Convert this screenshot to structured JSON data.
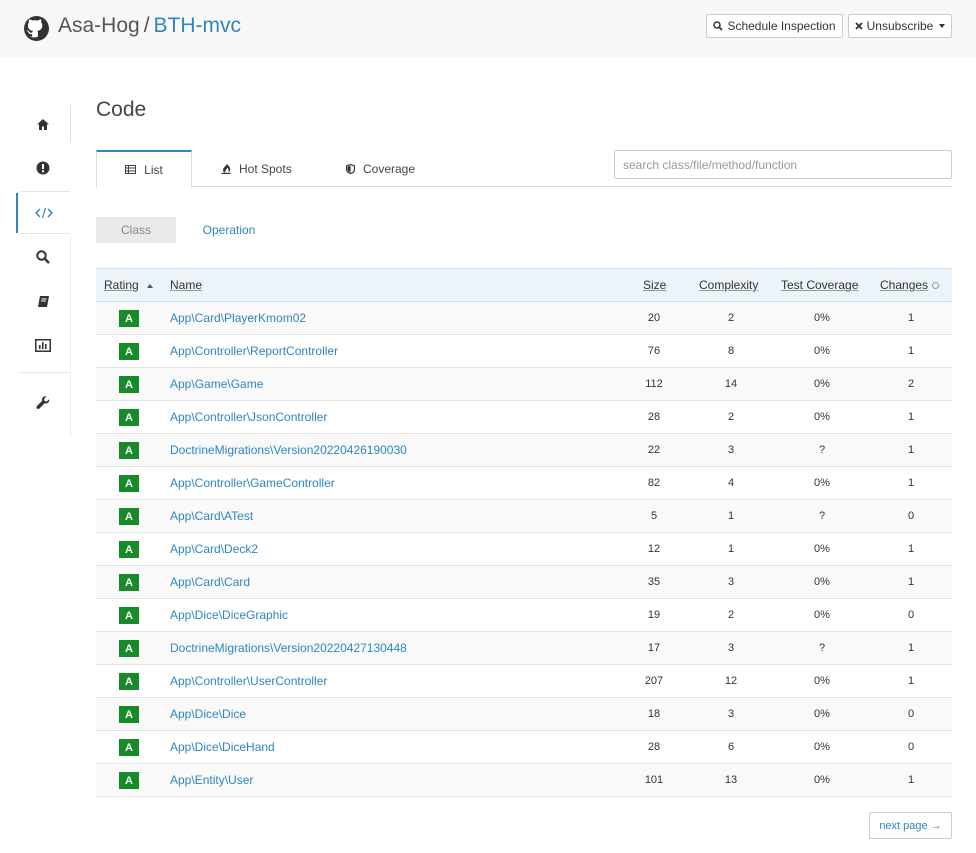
{
  "header": {
    "owner": "Asa-Hog",
    "separator": "/",
    "repo": "BTH-mvc",
    "schedule_label": "Schedule Inspection",
    "unsubscribe_label": "Unsubscribe"
  },
  "sidebar": {
    "items": [
      {
        "icon": "home-icon",
        "active": false
      },
      {
        "icon": "alert-icon",
        "active": false
      },
      {
        "icon": "code-icon",
        "active": true
      },
      {
        "icon": "search-icon",
        "active": false
      },
      {
        "icon": "book-icon",
        "active": false
      },
      {
        "icon": "chart-icon",
        "active": false
      },
      {
        "icon": "wrench-icon",
        "active": false
      }
    ]
  },
  "page": {
    "title": "Code"
  },
  "tabs": {
    "list": "List",
    "hotspots": "Hot Spots",
    "coverage": "Coverage"
  },
  "search": {
    "placeholder": "search class/file/method/function"
  },
  "subtabs": {
    "class": "Class",
    "operation": "Operation"
  },
  "table": {
    "headers": {
      "rating": "Rating",
      "name": "Name",
      "size": "Size",
      "complexity": "Complexity",
      "coverage": "Test Coverage",
      "changes": "Changes"
    },
    "rows": [
      {
        "rating": "A",
        "name": "App\\Card\\PlayerKmom02",
        "size": "20",
        "complexity": "2",
        "coverage": "0%",
        "changes": "1"
      },
      {
        "rating": "A",
        "name": "App\\Controller\\ReportController",
        "size": "76",
        "complexity": "8",
        "coverage": "0%",
        "changes": "1"
      },
      {
        "rating": "A",
        "name": "App\\Game\\Game",
        "size": "112",
        "complexity": "14",
        "coverage": "0%",
        "changes": "2"
      },
      {
        "rating": "A",
        "name": "App\\Controller\\JsonController",
        "size": "28",
        "complexity": "2",
        "coverage": "0%",
        "changes": "1"
      },
      {
        "rating": "A",
        "name": "DoctrineMigrations\\Version20220426190030",
        "size": "22",
        "complexity": "3",
        "coverage": "?",
        "changes": "1"
      },
      {
        "rating": "A",
        "name": "App\\Controller\\GameController",
        "size": "82",
        "complexity": "4",
        "coverage": "0%",
        "changes": "1"
      },
      {
        "rating": "A",
        "name": "App\\Card\\ATest",
        "size": "5",
        "complexity": "1",
        "coverage": "?",
        "changes": "0"
      },
      {
        "rating": "A",
        "name": "App\\Card\\Deck2",
        "size": "12",
        "complexity": "1",
        "coverage": "0%",
        "changes": "1"
      },
      {
        "rating": "A",
        "name": "App\\Card\\Card",
        "size": "35",
        "complexity": "3",
        "coverage": "0%",
        "changes": "1"
      },
      {
        "rating": "A",
        "name": "App\\Dice\\DiceGraphic",
        "size": "19",
        "complexity": "2",
        "coverage": "0%",
        "changes": "0"
      },
      {
        "rating": "A",
        "name": "DoctrineMigrations\\Version20220427130448",
        "size": "17",
        "complexity": "3",
        "coverage": "?",
        "changes": "1"
      },
      {
        "rating": "A",
        "name": "App\\Controller\\UserController",
        "size": "207",
        "complexity": "12",
        "coverage": "0%",
        "changes": "1"
      },
      {
        "rating": "A",
        "name": "App\\Dice\\Dice",
        "size": "18",
        "complexity": "3",
        "coverage": "0%",
        "changes": "0"
      },
      {
        "rating": "A",
        "name": "App\\Dice\\DiceHand",
        "size": "28",
        "complexity": "6",
        "coverage": "0%",
        "changes": "0"
      },
      {
        "rating": "A",
        "name": "App\\Entity\\User",
        "size": "101",
        "complexity": "13",
        "coverage": "0%",
        "changes": "1"
      }
    ]
  },
  "pagination": {
    "next_label": "next page →"
  },
  "colors": {
    "accent": "#2e86c1",
    "rating_a": "#178a2a"
  }
}
